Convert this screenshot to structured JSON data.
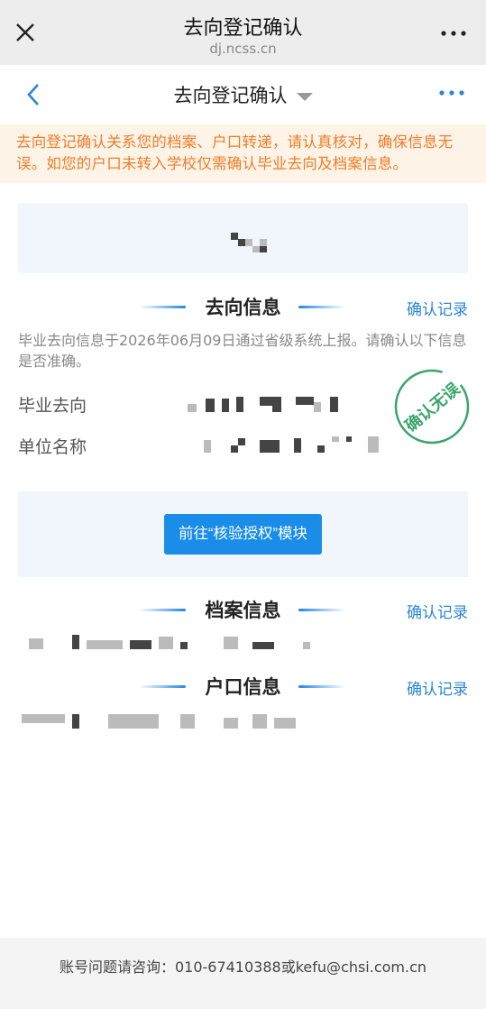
{
  "browser": {
    "title": "去向登记确认",
    "url": "dj.ncss.cn",
    "close_icon": "close-icon",
    "more_icon": "more-dots-icon"
  },
  "navbar": {
    "title": "去向登记确认",
    "back_icon": "chevron-left-icon",
    "caret_icon": "caret-down-icon",
    "more_icon": "more-dots-icon"
  },
  "notice": {
    "text": "去向登记确认关系您的档案、户口转递，请认真核对，确保信息无误。如您的户口未转入学校仅需确认毕业去向及档案信息。"
  },
  "destination": {
    "section_title": "去向信息",
    "record_link": "确认记录",
    "description": "毕业去向信息于2026年06月09日通过省级系统上报。请确认以下信息是否准确。",
    "fields": [
      {
        "label": "毕业去向"
      },
      {
        "label": "单位名称"
      }
    ],
    "stamp_text": "确认无误"
  },
  "action": {
    "button_label": "前往“核验授权”模块"
  },
  "archive": {
    "section_title": "档案信息",
    "record_link": "确认记录"
  },
  "hukou": {
    "section_title": "户口信息",
    "record_link": "确认记录"
  },
  "footer": {
    "text": "账号问题请咨询：010-67410388或kefu@chsi.com.cn"
  },
  "colors": {
    "accent_blue": "#1a8de9",
    "link_blue": "#2a85d8",
    "notice_orange": "#ee7d2a",
    "notice_bg": "#fdf3e6",
    "stamp_green": "#3aa56a",
    "panel_bg": "#f1f6fd"
  }
}
